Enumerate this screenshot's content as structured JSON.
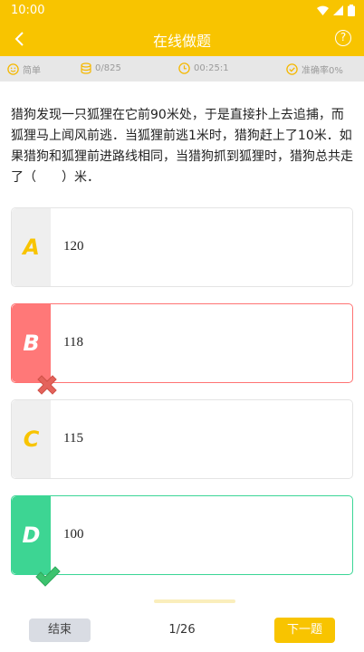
{
  "status": {
    "time": "10:00"
  },
  "header": {
    "title": "在线做题",
    "help_glyph": "?"
  },
  "info": {
    "difficulty": "简单",
    "count": "0/825",
    "timer": "00:25:1",
    "accuracy": "准确率0%"
  },
  "question": {
    "text": "猎狗发现一只狐狸在它前90米处，于是直接扑上去追捕，而狐狸马上闻风前逃．当狐狸前逃1米时，猎狗赶上了10米．如果猎狗和狐狸前进路线相同，当猎狗抓到狐狸时，猎狗总共走了（　　）米．"
  },
  "options": [
    {
      "letter": "A",
      "value": "120",
      "state": "normal"
    },
    {
      "letter": "B",
      "value": "118",
      "state": "wrong"
    },
    {
      "letter": "C",
      "value": "115",
      "state": "normal"
    },
    {
      "letter": "D",
      "value": "100",
      "state": "correct"
    }
  ],
  "footer": {
    "end_label": "结束",
    "page": "1/26",
    "next_label": "下一题"
  },
  "colors": {
    "accent": "#F8C400",
    "wrong": "#FF7878",
    "correct": "#3DD593"
  }
}
